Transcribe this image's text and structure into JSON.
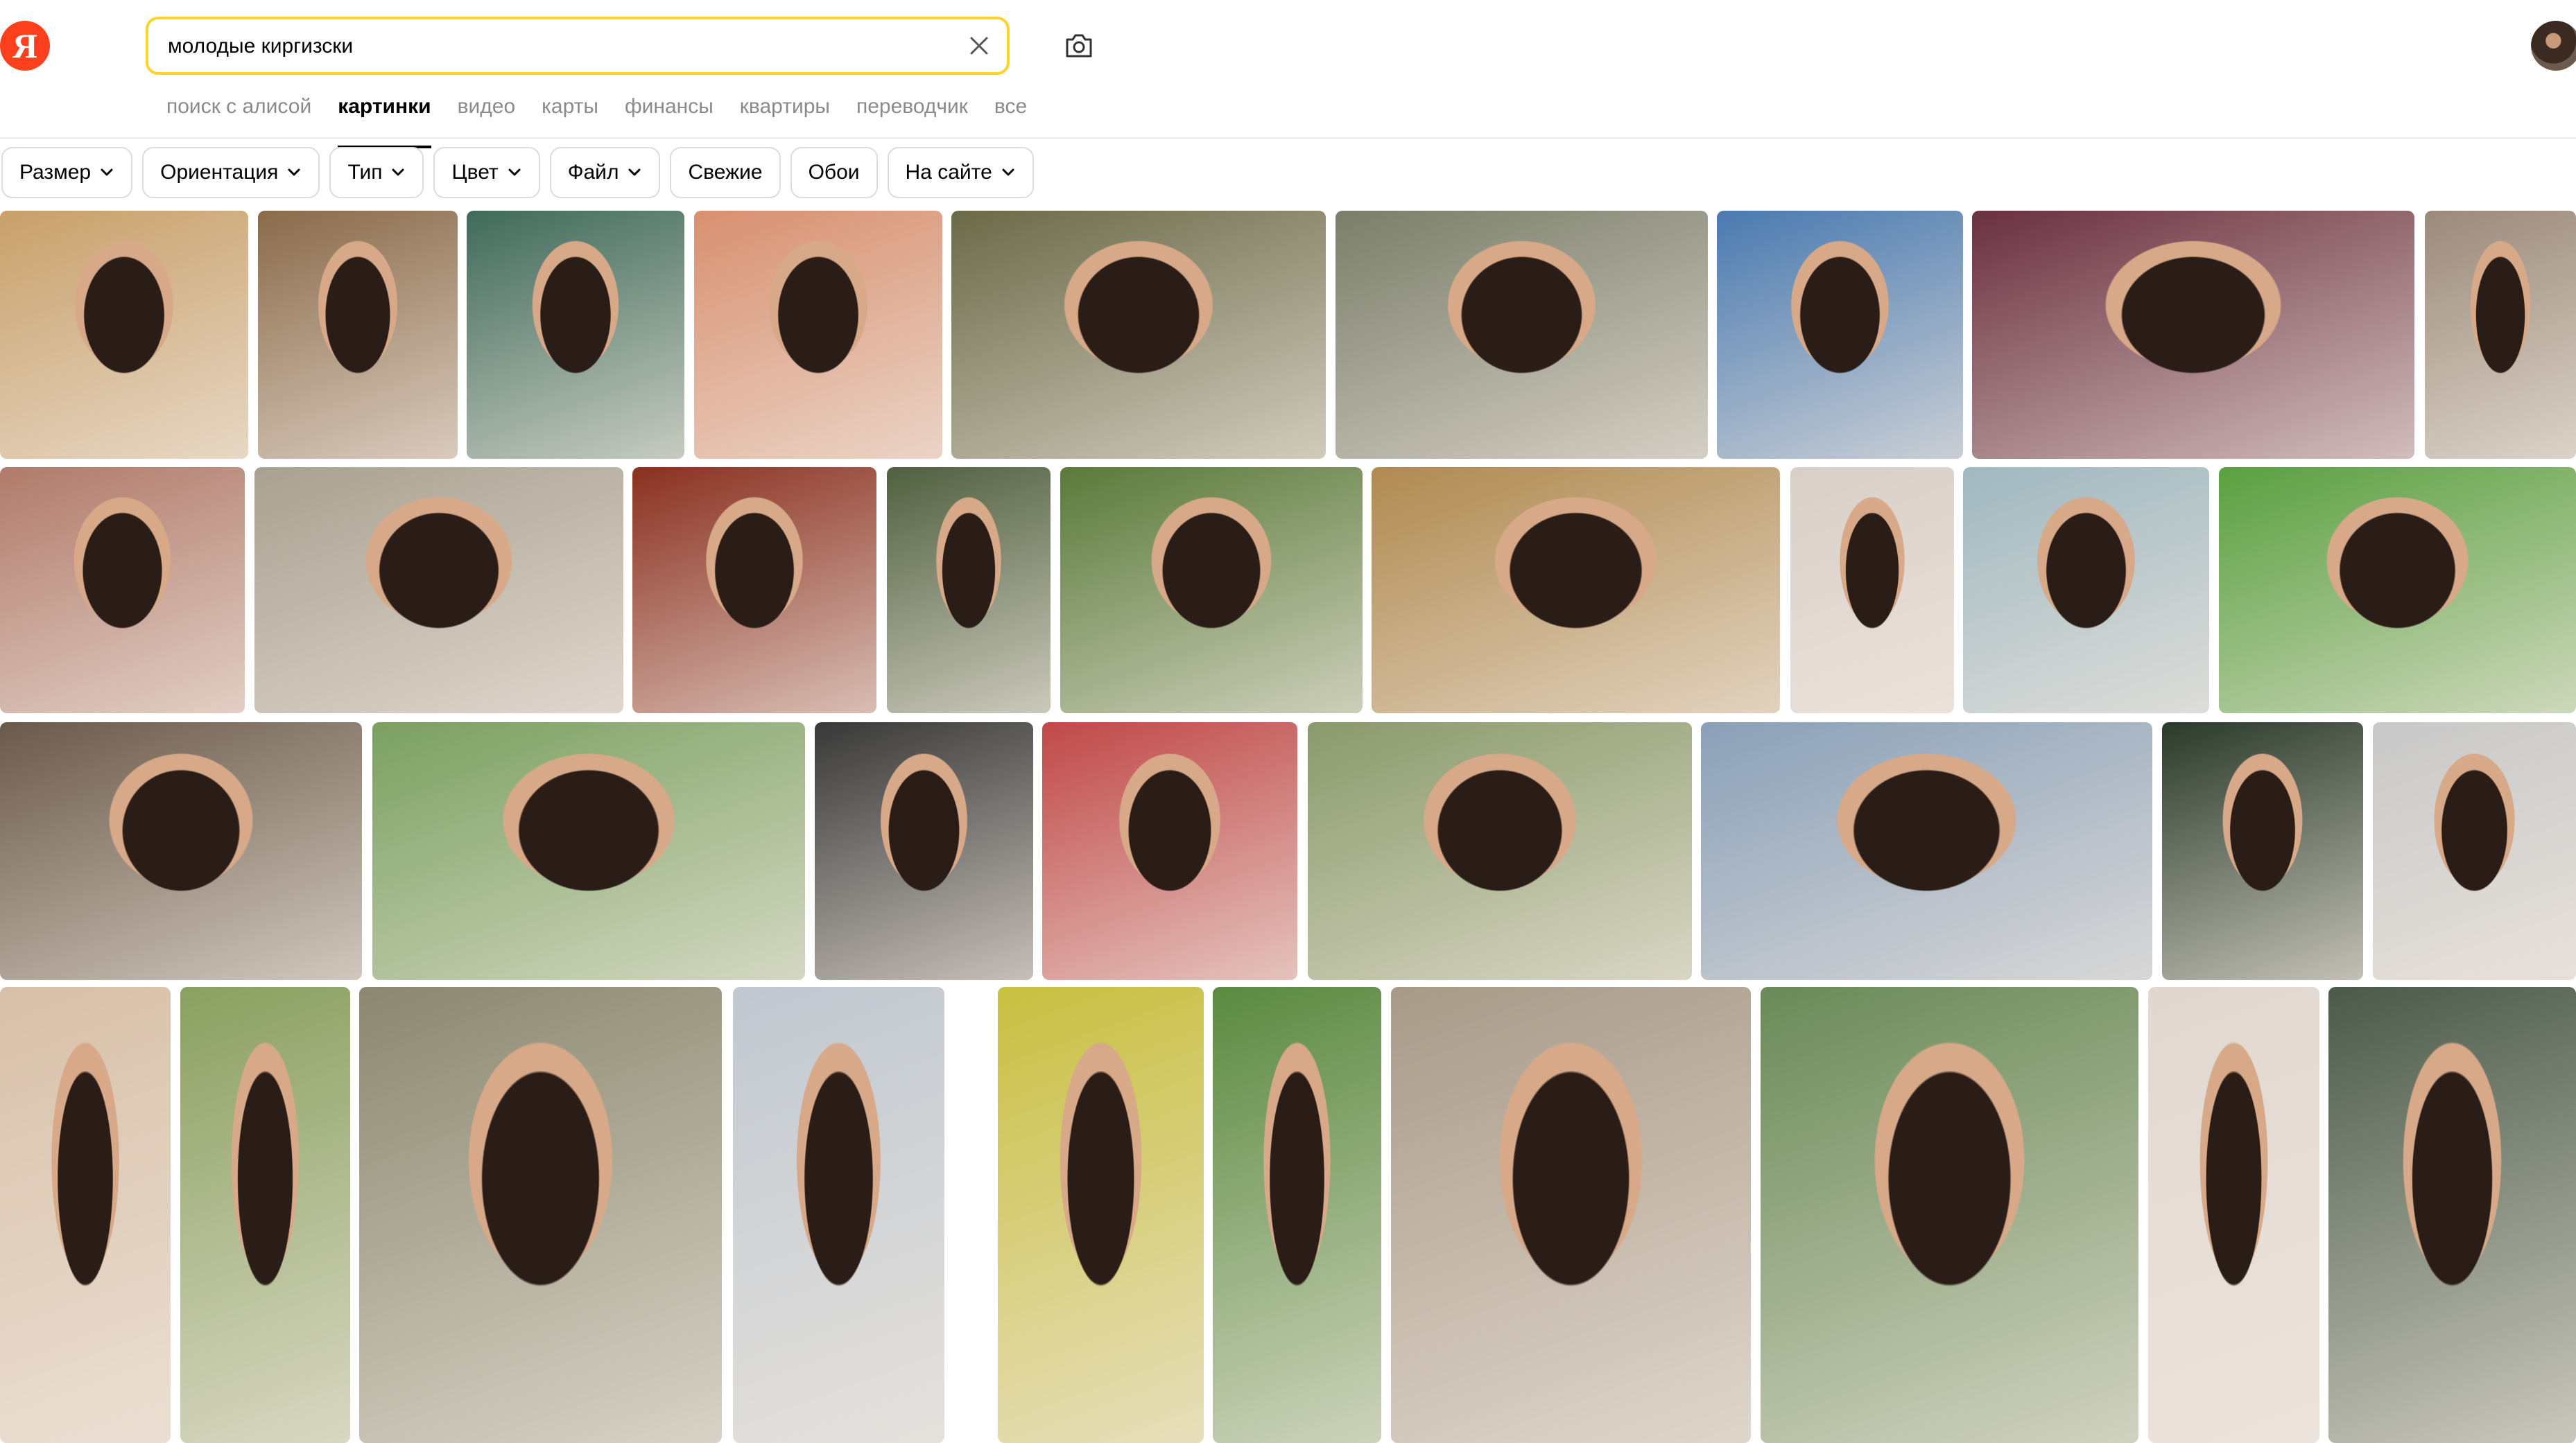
{
  "logo": {
    "text": "Я"
  },
  "search": {
    "value": "молодые киргизски"
  },
  "tabs": [
    {
      "label": "поиск с алисой",
      "active": false
    },
    {
      "label": "картинки",
      "active": true
    },
    {
      "label": "видео",
      "active": false
    },
    {
      "label": "карты",
      "active": false
    },
    {
      "label": "финансы",
      "active": false
    },
    {
      "label": "квартиры",
      "active": false
    },
    {
      "label": "переводчик",
      "active": false
    },
    {
      "label": "все",
      "active": false
    }
  ],
  "filters": [
    {
      "label": "Размер",
      "dropdown": true
    },
    {
      "label": "Ориентация",
      "dropdown": true
    },
    {
      "label": "Тип",
      "dropdown": true
    },
    {
      "label": "Цвет",
      "dropdown": true
    },
    {
      "label": "Файл",
      "dropdown": true
    },
    {
      "label": "Свежие",
      "dropdown": false
    },
    {
      "label": "Обои",
      "dropdown": false
    },
    {
      "label": "На сайте",
      "dropdown": true
    }
  ],
  "colors": {
    "accent": "#fed42b",
    "brand": "#fc3f1d"
  },
  "image_rows": [
    [
      "#c8a06a",
      "#8a6a4a",
      "#3f6a5a",
      "#d89070",
      "#6a6a48",
      "#7a7e6a",
      "#4a7ab0",
      "#6a3040",
      "#9a8a7a"
    ],
    [
      "#b07a6a",
      "#a8a090",
      "#8a3020",
      "#506040",
      "#5a7a3a",
      "#b08a50",
      "#d8d0c8",
      "#a0b8c0",
      "#5aa040"
    ],
    [
      "#6a5a4a",
      "#7aa060",
      "#383838",
      "#c04848",
      "#8a9a6a",
      "#8aa0b8",
      "#2a3a2a",
      "#c8c8c8"
    ],
    [
      "#d8c0a8",
      "#8aa060",
      "#8a8870",
      "#c0c8d0",
      "#c8c040",
      "#5a8a40",
      "#a89a88",
      "#6a8a58",
      "#e0d8d0",
      "#4a5a48"
    ]
  ]
}
